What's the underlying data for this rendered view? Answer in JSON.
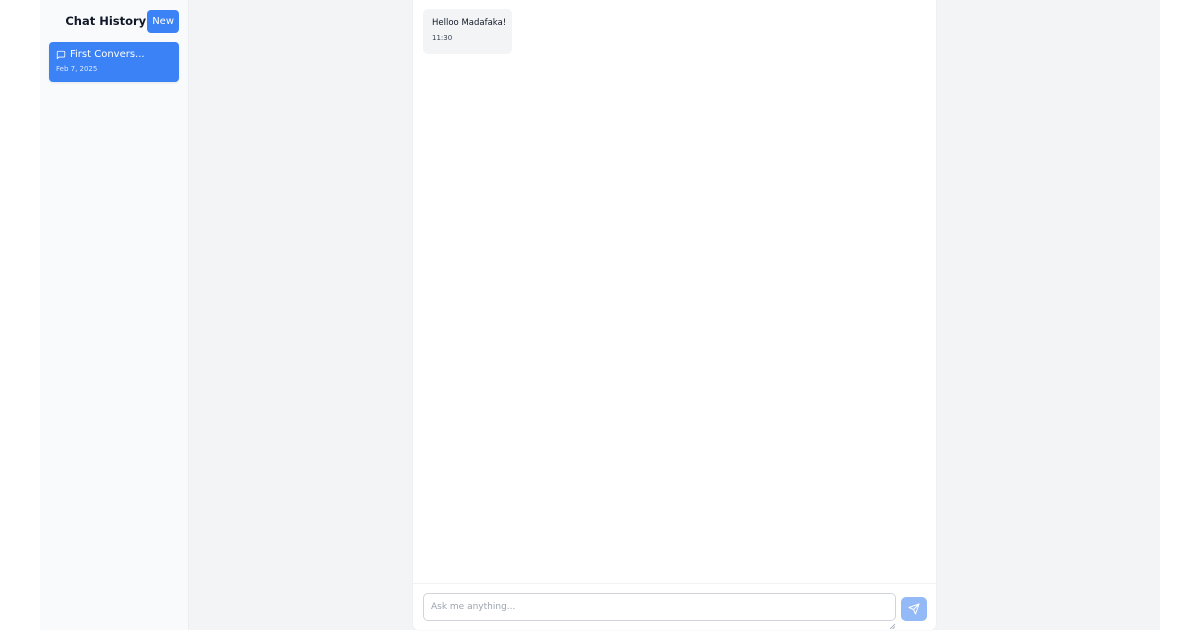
{
  "sidebar": {
    "title": "Chat History",
    "new_label": "New",
    "conversations": [
      {
        "title": "First Convers...",
        "date": "Feb 7, 2025",
        "active": true
      }
    ]
  },
  "chat": {
    "messages": [
      {
        "text": "Helloo Madafaka!",
        "time": "11:30"
      }
    ],
    "composer": {
      "placeholder": "Ask me anything...",
      "value": ""
    }
  },
  "icons": {
    "conversation": "message-square-icon",
    "send": "send-icon"
  },
  "colors": {
    "accent": "#3b82f6",
    "accent_disabled": "#93b9f7",
    "sidebar_bg": "#f9fafb",
    "main_bg": "#f3f4f6",
    "bubble_bg": "#f3f4f6"
  }
}
